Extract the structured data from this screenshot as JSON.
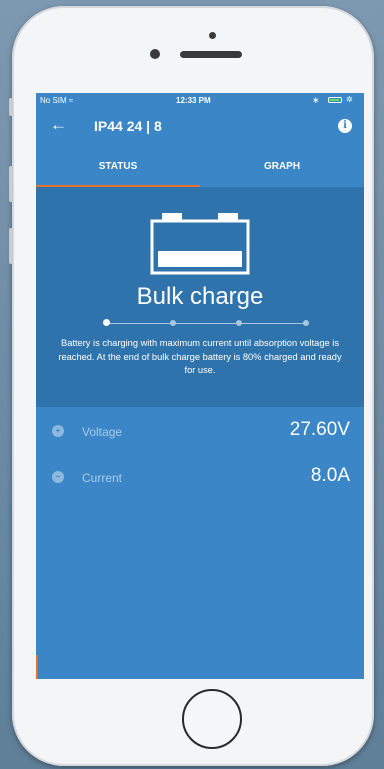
{
  "status_bar": {
    "carrier": "No SIM ≈",
    "time": "12:33 PM",
    "bluetooth": "∗",
    "charging_icon": "✲"
  },
  "app_bar": {
    "back_icon": "←",
    "title": "IP44 24 | 8",
    "info_icon": "i"
  },
  "tabs": [
    {
      "label": "STATUS",
      "active": true
    },
    {
      "label": "GRAPH",
      "active": false
    }
  ],
  "status": {
    "state": "Bulk charge",
    "step_index": 0,
    "step_count": 4,
    "description": "Battery is charging with maximum current until absorption voltage is reached. At the end of bulk charge battery is 80% charged and ready for use."
  },
  "readings": [
    {
      "label": "Voltage",
      "value": "27.60V",
      "icon": "voltage-icon"
    },
    {
      "label": "Current",
      "value": "8.0A",
      "icon": "current-icon"
    }
  ],
  "colors": {
    "primary": "#3a86c6",
    "panel": "#2f73ac",
    "accent": "#e0702a"
  }
}
